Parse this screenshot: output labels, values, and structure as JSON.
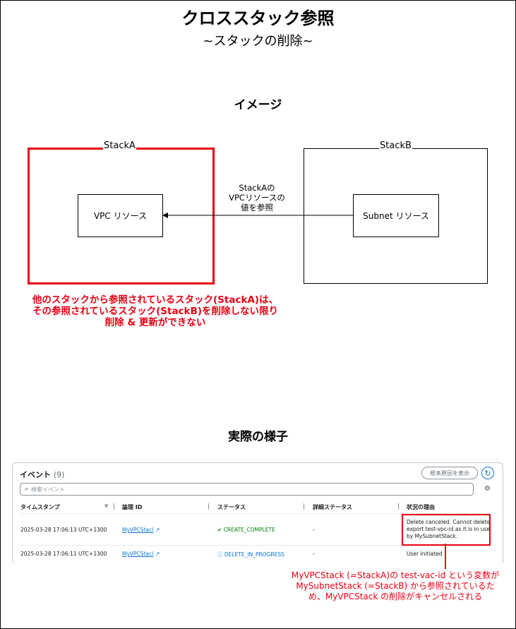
{
  "header": {
    "title": "クロススタック参照",
    "subtitle": "~スタックの削除~"
  },
  "diagram": {
    "section_title": "イメージ",
    "stack_a_label": "StackA",
    "stack_b_label": "StackB",
    "vpc_resource": "VPC リソース",
    "subnet_resource": "Subnet リソース",
    "arrow_label_lines": [
      "StackAの",
      "VPCリソースの",
      "値を参照"
    ],
    "note_lines": [
      "他のスタックから参照されているスタック(StackA)は、",
      "その参照されているスタック(StackB)を削除しない限り",
      "削除 & 更新ができない"
    ],
    "colors": {
      "highlight": "#e60012"
    }
  },
  "actual": {
    "section_title": "実際の様子",
    "panel": {
      "title": "イベント",
      "count": "(9)",
      "root_cause_button": "根本原因を表示",
      "refresh_icon": "refresh-icon",
      "search_placeholder": "検索イベント",
      "settings_icon": "gear-icon",
      "columns": [
        "タイムスタンプ",
        "論理 ID",
        "ステータス",
        "詳細ステータス",
        "状況の理由"
      ],
      "rows": [
        {
          "timestamp": "2025-03-28 17:06:13 UTC+1300",
          "logical_id": "MyVPCStacl",
          "status": "CREATE_COMPLETE",
          "detailed_status": "-",
          "reason_lines": [
            "Delete canceled. Cannot delete",
            "export test-vpc-id as it is in use",
            "by MySubnetStack."
          ]
        },
        {
          "timestamp": "2025-03-28 17:06:11 UTC+1300",
          "logical_id": "MyVPCStacl",
          "status": "DELETE_IN_PROGRESS",
          "detailed_status": "-",
          "reason_lines": [
            "User Initiated"
          ]
        }
      ]
    },
    "note_lines": [
      "MyVPCStack (=StackA)の test-vac-id という変数が",
      "MySubnetStack (=StackB) から参照されているた",
      "め、MyVPCStack の削除がキャンセルされる"
    ]
  }
}
